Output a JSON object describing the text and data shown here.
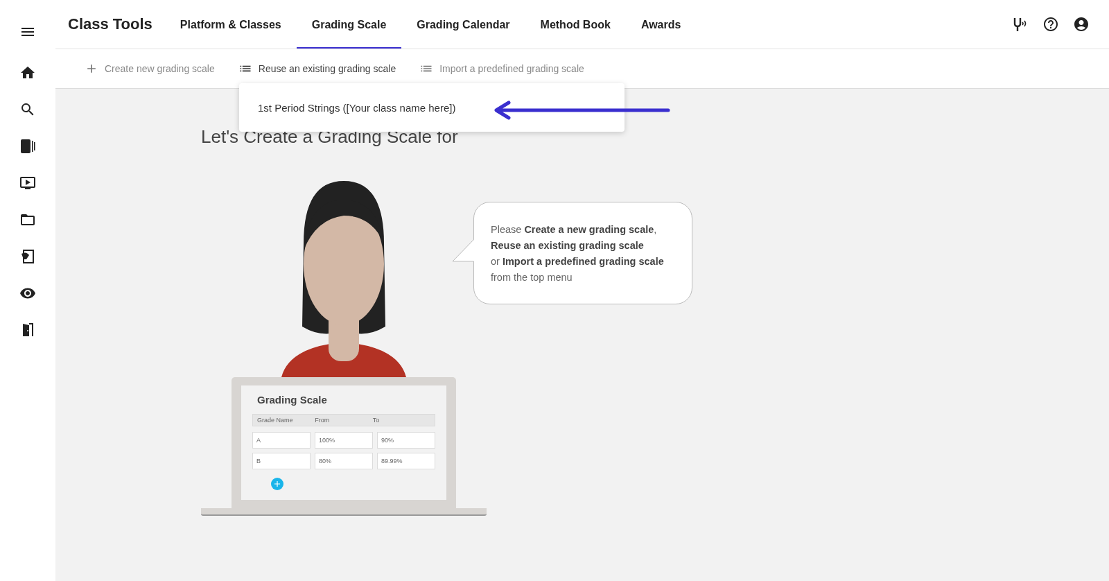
{
  "app": {
    "title": "Class Tools"
  },
  "tabs": [
    {
      "label": "Platform & Classes",
      "selected": false
    },
    {
      "label": "Grading Scale",
      "selected": true
    },
    {
      "label": "Grading Calendar",
      "selected": false
    },
    {
      "label": "Method Book",
      "selected": false
    },
    {
      "label": "Awards",
      "selected": false
    }
  ],
  "actions": [
    {
      "label": "Create new grading scale",
      "kind": "plus",
      "selected": false
    },
    {
      "label": "Reuse an existing grading scale",
      "kind": "list",
      "selected": true
    },
    {
      "label": "Import a predefined grading scale",
      "kind": "list",
      "selected": false
    }
  ],
  "dropdown": {
    "items": [
      "1st Period Strings ([Your class name here])"
    ]
  },
  "heading": "Let's Create a Grading Scale for",
  "bubble": {
    "text": "Please **Create a new grading scale**,\n**Reuse an existing grading scale**\nor **Import a predefined grading scale**\nfrom the top menu"
  },
  "laptop": {
    "title": "Grading Scale",
    "columns": [
      "Grade Name",
      "From",
      "To"
    ],
    "rows": [
      [
        "A",
        "100%",
        "90%"
      ],
      [
        "B",
        "80%",
        "89.99%"
      ]
    ]
  }
}
